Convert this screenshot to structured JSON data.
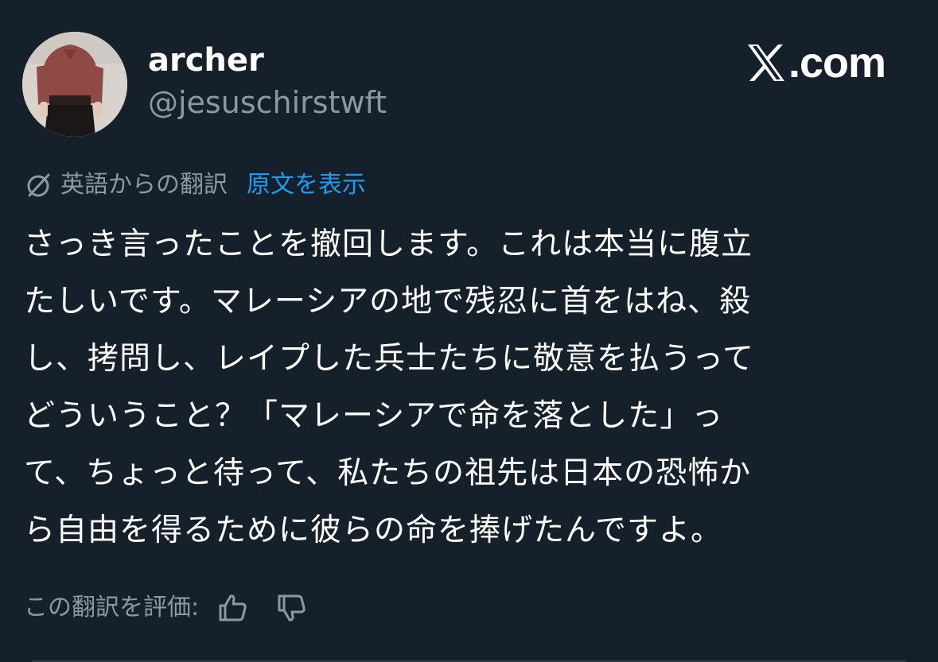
{
  "author": {
    "display_name": "archer",
    "handle": "@jesuschirstwft"
  },
  "brand": {
    "icon": "x-logo-icon",
    "domain": ".com"
  },
  "translation": {
    "icon": "translate-icon",
    "translated_from": "英語からの翻訳",
    "show_original": "原文を表示"
  },
  "tweet": {
    "lines": [
      "さっき言ったことを撤回します。これは本当に腹立",
      "たしいです。マレーシアの地で残忍に首をはね、殺",
      "し、拷問し、レイプした兵士たちに敬意を払うって",
      "どういうこと？「マレーシアで命を落とした」っ",
      "て、ちょっと待って、私たちの祖先は日本の恐怖か",
      "ら自由を得るために彼らの命を捧げたんですよ。"
    ]
  },
  "rating": {
    "label": "この翻訳を評価:",
    "up_icon": "thumbs-up-icon",
    "down_icon": "thumbs-down-icon"
  },
  "colors": {
    "background": "#15202b",
    "primary_text": "#ffffff",
    "secondary_text": "#8b98a5",
    "link": "#1d9bf0"
  }
}
